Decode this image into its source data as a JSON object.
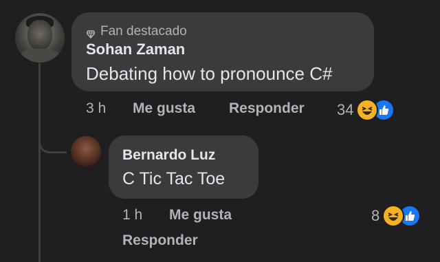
{
  "comment": {
    "badge": "Fan destacado",
    "author": "Sohan Zaman",
    "text": "Debating how to pronounce C#",
    "time": "3 h",
    "like_label": "Me gusta",
    "reply_label": "Responder",
    "reaction_count": "34",
    "reaction_icons": [
      "haha-icon",
      "like-icon"
    ]
  },
  "reply": {
    "author": "Bernardo Luz",
    "text": "C Tic Tac Toe",
    "time": "1 h",
    "like_label": "Me gusta",
    "reply_label": "Responder",
    "reaction_count": "8",
    "reaction_icons": [
      "haha-icon",
      "like-icon"
    ]
  },
  "colors": {
    "background": "#1f1f21",
    "bubble": "#3a3b3c",
    "primary_text": "#e4e6eb",
    "secondary_text": "#b0b3b8",
    "haha": "#f7b125",
    "like": "#1877f2"
  }
}
